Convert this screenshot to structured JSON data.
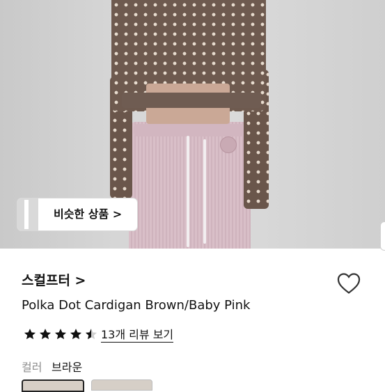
{
  "product_image": {
    "similar_products_button": "비슷한 상품 >"
  },
  "product": {
    "brand": "스컬프터 >",
    "title": "Polka Dot Cardigan Brown/Baby Pink",
    "rating": {
      "value": 4.5,
      "max": 5
    },
    "reviews_link": "13개 리뷰 보기"
  },
  "options": {
    "color_label": "컬러",
    "color_value": "브라운",
    "swatches": [
      "brown",
      "pink"
    ]
  },
  "icons": {
    "wishlist": "heart-outline-icon",
    "star": "star-icon",
    "chevron": "chevron-right-icon"
  }
}
